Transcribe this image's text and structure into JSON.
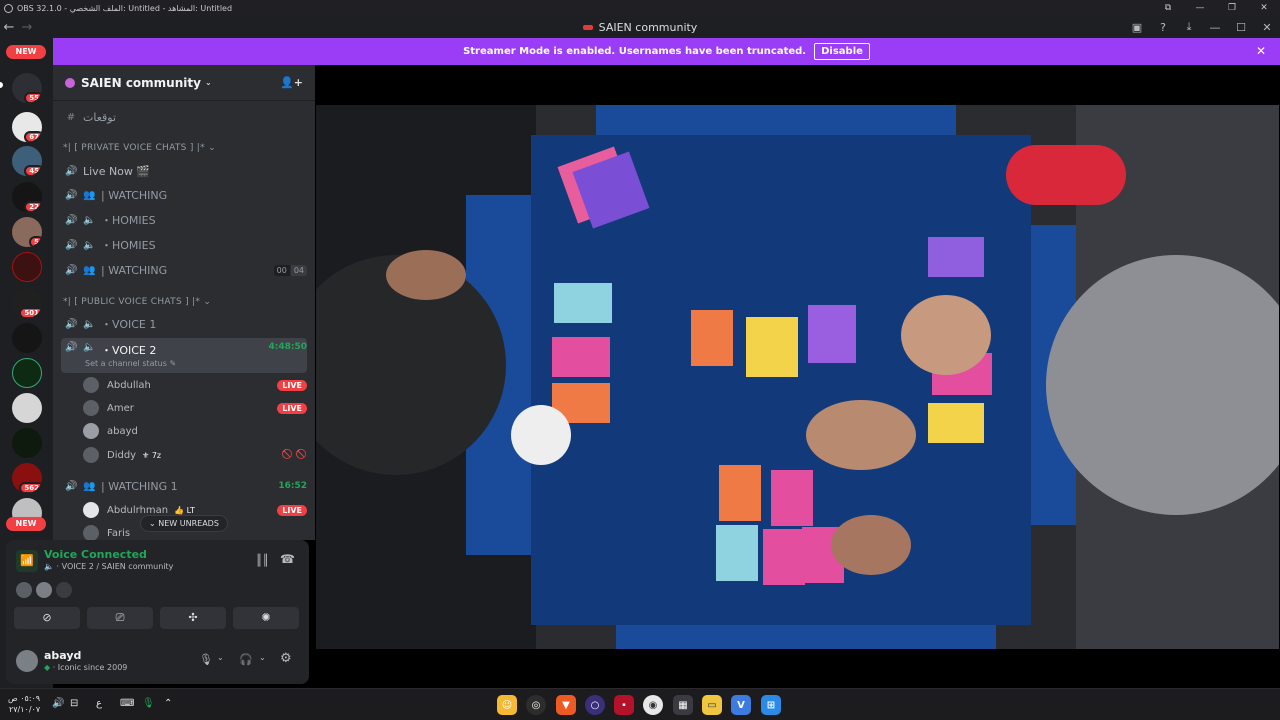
{
  "obs_title": {
    "text": "OBS 32.1.0 - الملف الشخصي: Untitled - المشاهد: Untitled"
  },
  "window": {
    "title": "SAIEN community"
  },
  "banner": {
    "text": "Streamer Mode is enabled. Usernames have been truncated.",
    "button": "Disable"
  },
  "servers": {
    "new_top": "NEW",
    "new_bottom": "NEW",
    "badges": [
      "55",
      "67",
      "45",
      "22",
      "5",
      "501",
      "562"
    ]
  },
  "guild": {
    "name": "SAIEN community"
  },
  "channels": {
    "text_channel": "توقعات",
    "cat_private": "*| [ PRIVATE VOICE CHATS ] |*",
    "cat_public": "*| [ PUBLIC VOICE CHATS ] |*",
    "live_now": "Live Now 🎬",
    "watching": "| WATCHING",
    "homies1": "・HOMIES",
    "homies2": "・HOMIES",
    "watching2": "| WATCHING",
    "watching2_counter_a": "00",
    "watching2_counter_b": "04",
    "voice1": "・VOICE 1",
    "voice2": "・VOICE 2",
    "voice2_time": "4:48:50",
    "voice2_status": "Set a channel status",
    "watching1": "| WATCHING 1",
    "watching1_time": "16:52"
  },
  "voice_users": [
    {
      "name": "Abdullah",
      "live": "LIVE"
    },
    {
      "name": "Amer",
      "live": "LIVE"
    },
    {
      "name": "abayd",
      "live": ""
    },
    {
      "name": "Diddy",
      "tag": "7z",
      "live": ""
    },
    {
      "name": "Abdulrhman",
      "tag": "LT",
      "live": "LIVE"
    },
    {
      "name": "Faris",
      "live": ""
    }
  ],
  "new_unreads": "NEW UNREADS",
  "voice_panel": {
    "title": "Voice Connected",
    "sub": "VOICE 2 / SAIEN community"
  },
  "user_panel": {
    "name": "abayd",
    "status": "Iconic since 2009"
  },
  "taskbar": {
    "time": "٠٥:٠٩ ص",
    "date": "٢٧/١٠/٠٧",
    "lang": "ع"
  }
}
